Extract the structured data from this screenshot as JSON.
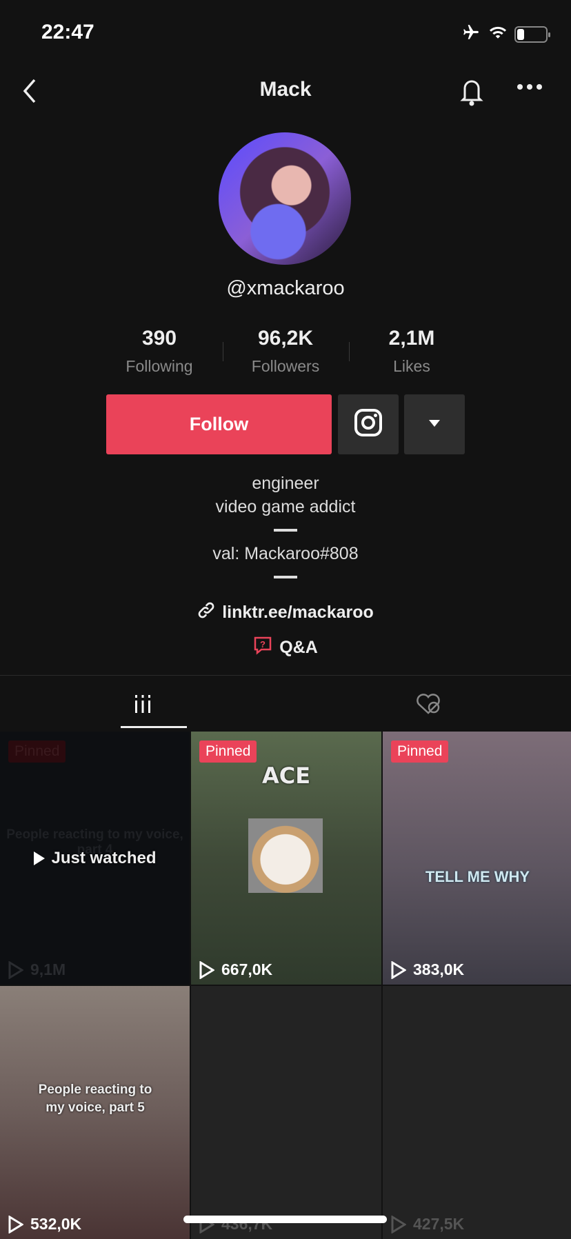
{
  "status_bar": {
    "time": "22:47",
    "battery_level": 0.25
  },
  "header": {
    "title": "Mack"
  },
  "profile": {
    "handle": "@xmackaroo",
    "stats": [
      {
        "value": "390",
        "label": "Following"
      },
      {
        "value": "96,2K",
        "label": "Followers"
      },
      {
        "value": "2,1M",
        "label": "Likes"
      }
    ],
    "follow_label": "Follow",
    "bio": [
      "engineer",
      "video game addict",
      "val: Mackaroo#808"
    ],
    "link": "linktr.ee/mackaroo",
    "qa": "Q&A"
  },
  "videos": [
    {
      "pinned": "Pinned",
      "views": "9,1M",
      "caption": "People reacting to my voice, part 4",
      "overlay": "Just watched"
    },
    {
      "pinned": "Pinned",
      "views": "667,0K",
      "caption": "ACE"
    },
    {
      "pinned": "Pinned",
      "views": "383,0K",
      "caption": "TELL ME WHY"
    },
    {
      "views": "532,0K",
      "caption": "People reacting to my voice, part 5"
    },
    {
      "views": "436,7K"
    },
    {
      "views": "427,5K"
    }
  ],
  "colors": {
    "accent": "#ea4359",
    "background": "#121212"
  }
}
